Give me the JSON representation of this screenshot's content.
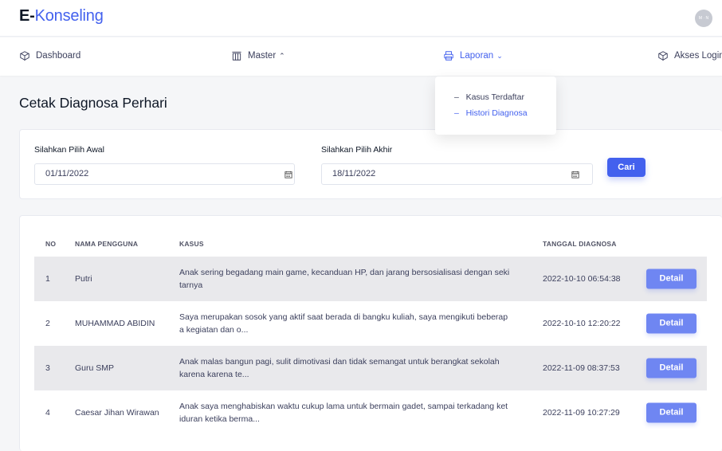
{
  "header": {
    "brand_bold": "E-",
    "brand_rest": "Konseling",
    "avatar_text": "M · N"
  },
  "nav": {
    "items": [
      {
        "label": "Dashboard",
        "icon": "cube-icon"
      },
      {
        "label": "Master",
        "icon": "columns-icon",
        "chevron": "^"
      },
      {
        "label": "Laporan",
        "icon": "printer-icon",
        "chevron": "v",
        "active": true
      },
      {
        "label": "Akses Login",
        "icon": "cube-icon"
      }
    ]
  },
  "dropdown": {
    "items": [
      {
        "label": "Kasus Terdaftar"
      },
      {
        "label": "Histori Diagnosa",
        "active": true
      }
    ]
  },
  "page": {
    "title": "Cetak Diagnosa Perhari"
  },
  "filter": {
    "start_label": "Silahkan Pilih Awal",
    "start_value": "01/11/2022",
    "end_label": "Silahkan Pilih Akhir",
    "end_value": "18/11/2022",
    "search_label": "Cari"
  },
  "table": {
    "headers": [
      "NO",
      "NAMA PENGGUNA",
      "KASUS",
      "TANGGAL DIAGNOSA"
    ],
    "rows": [
      {
        "no": "1",
        "name": "Putri",
        "kasus_l1": "Anak sering begadang main game, kecanduan HP, dan jarang bersosialisasi dengan seki",
        "kasus_l2": "tarnya",
        "date": "2022-10-10 06:54:38",
        "action": "Detail"
      },
      {
        "no": "2",
        "name": "MUHAMMAD ABIDIN",
        "kasus_l1": "Saya merupakan sosok yang aktif saat berada di bangku kuliah, saya mengikuti beberap",
        "kasus_l2": "a kegiatan dan o...",
        "date": "2022-10-10 12:20:22",
        "action": "Detail"
      },
      {
        "no": "3",
        "name": "Guru SMP",
        "kasus_l1": "Anak malas bangun pagi, sulit dimotivasi dan tidak semangat untuk berangkat sekolah",
        "kasus_l2": "karena karena te...",
        "date": "2022-11-09 08:37:53",
        "action": "Detail"
      },
      {
        "no": "4",
        "name": "Caesar Jihan Wirawan",
        "kasus_l1": "Anak saya menghabiskan waktu cukup lama untuk bermain gadet, sampai terkadang ket",
        "kasus_l2": "iduran ketika berma...",
        "date": "2022-11-09 10:27:29",
        "action": "Detail"
      }
    ]
  },
  "colors": {
    "accent": "#4361ee",
    "detail_button": "#6f86f2",
    "row_shade": "#e9e9ec"
  }
}
